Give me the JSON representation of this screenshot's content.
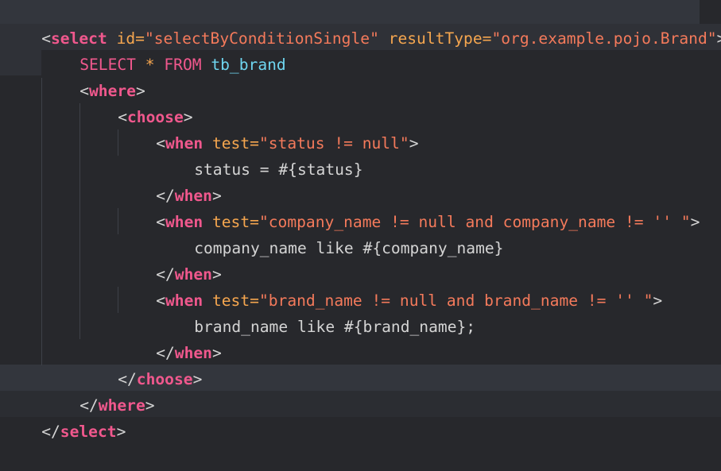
{
  "editor": {
    "colors": {
      "background": "#27282c",
      "current_line": "#33363d",
      "tag": "#f0588d",
      "attribute": "#f5a64f",
      "string": "#f47a5b",
      "keyword": "#f0588d",
      "identifier": "#6fd6f0",
      "text": "#d4d4d4"
    },
    "lines": [
      [
        "<",
        "select",
        " ",
        "id",
        "=",
        "\"selectByConditionSingle\"",
        " ",
        "resultType",
        "=",
        "\"org.example.pojo.Brand\"",
        ">"
      ],
      [
        "SELECT",
        " ",
        "*",
        " ",
        "FROM",
        " ",
        "tb_brand"
      ],
      [
        "<",
        "where",
        ">"
      ],
      [
        "<",
        "choose",
        ">"
      ],
      [
        "<",
        "when",
        " ",
        "test",
        "=",
        "\"status != null\"",
        ">"
      ],
      [
        "status = #{status}"
      ],
      [
        "</",
        "when",
        ">"
      ],
      [
        "<",
        "when",
        " ",
        "test",
        "=",
        "\"company_name != null and company_name != '' \"",
        ">"
      ],
      [
        "company_name like #{company_name}"
      ],
      [
        "</",
        "when",
        ">"
      ],
      [
        "<",
        "when",
        " ",
        "test",
        "=",
        "\"brand_name != null and brand_name != '' \"",
        ">"
      ],
      [
        "brand_name like #{brand_name};"
      ],
      [
        "</",
        "when",
        ">"
      ],
      [
        "</",
        "choose",
        ">"
      ],
      [
        "</",
        "where",
        ">"
      ],
      [
        "</",
        "select",
        ">"
      ]
    ]
  }
}
